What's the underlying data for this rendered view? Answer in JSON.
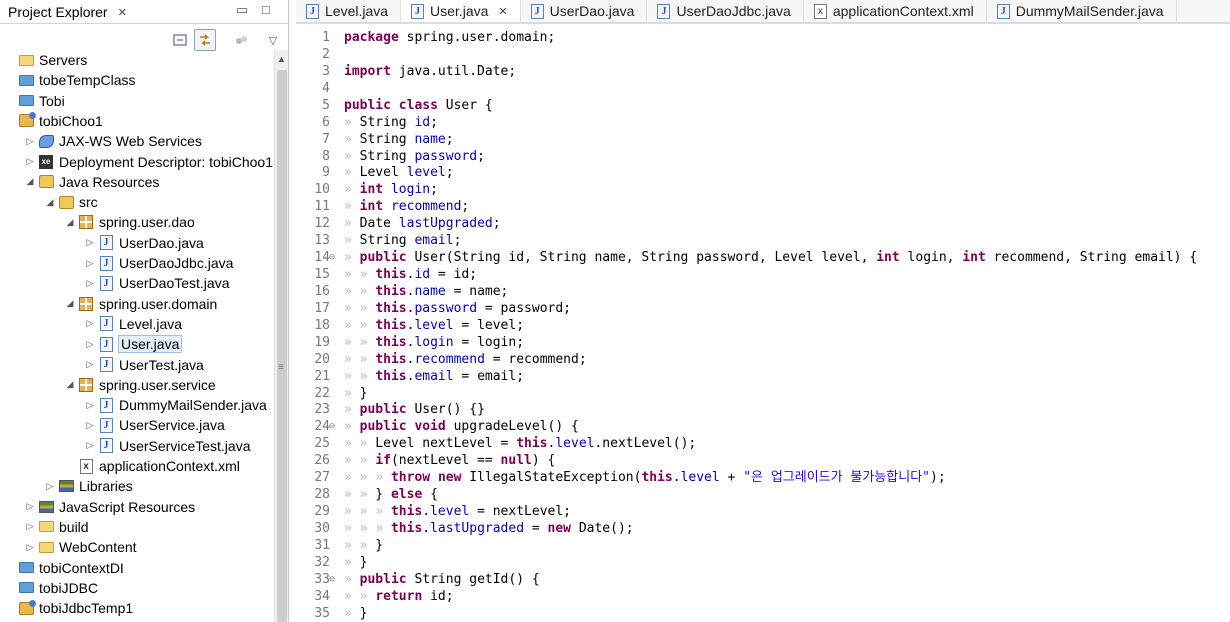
{
  "explorer": {
    "tab_label": "Project Explorer",
    "tab_close": "✕",
    "minimize": "▭",
    "maximize": "□",
    "view_menu": "▽",
    "tree": [
      {
        "label": "Servers",
        "icon": "folder-open-icon",
        "indent": 0,
        "twisty": ""
      },
      {
        "label": "tobeTempClass",
        "icon": "project-folder-icon",
        "indent": 0,
        "twisty": ""
      },
      {
        "label": "Tobi",
        "icon": "project-folder-icon",
        "indent": 0,
        "twisty": ""
      },
      {
        "label": "tobiChoo1",
        "icon": "web-project-icon",
        "indent": 0,
        "twisty": ""
      },
      {
        "label": "JAX-WS Web Services",
        "icon": "web-services-icon",
        "indent": 1,
        "twisty": "▷"
      },
      {
        "label": "Deployment Descriptor: tobiChoo1",
        "icon": "deployment-descriptor-icon",
        "indent": 1,
        "twisty": "▷"
      },
      {
        "label": "Java Resources",
        "icon": "java-resources-icon",
        "indent": 1,
        "twisty": "◢"
      },
      {
        "label": "src",
        "icon": "source-folder-icon",
        "indent": 2,
        "twisty": "◢"
      },
      {
        "label": "spring.user.dao",
        "icon": "package-icon",
        "indent": 3,
        "twisty": "◢"
      },
      {
        "label": "UserDao.java",
        "icon": "java-file-icon",
        "indent": 4,
        "twisty": "▷"
      },
      {
        "label": "UserDaoJdbc.java",
        "icon": "java-file-icon",
        "indent": 4,
        "twisty": "▷"
      },
      {
        "label": "UserDaoTest.java",
        "icon": "java-file-icon",
        "indent": 4,
        "twisty": "▷"
      },
      {
        "label": "spring.user.domain",
        "icon": "package-icon",
        "indent": 3,
        "twisty": "◢"
      },
      {
        "label": "Level.java",
        "icon": "java-file-icon",
        "indent": 4,
        "twisty": "▷"
      },
      {
        "label": "User.java",
        "icon": "java-file-icon",
        "indent": 4,
        "twisty": "▷",
        "selected": true
      },
      {
        "label": "UserTest.java",
        "icon": "java-file-icon",
        "indent": 4,
        "twisty": "▷"
      },
      {
        "label": "spring.user.service",
        "icon": "package-icon",
        "indent": 3,
        "twisty": "◢"
      },
      {
        "label": "DummyMailSender.java",
        "icon": "java-file-icon",
        "indent": 4,
        "twisty": "▷"
      },
      {
        "label": "UserService.java",
        "icon": "java-file-icon",
        "indent": 4,
        "twisty": "▷"
      },
      {
        "label": "UserServiceTest.java",
        "icon": "java-file-icon",
        "indent": 4,
        "twisty": "▷"
      },
      {
        "label": "applicationContext.xml",
        "icon": "xml-file-icon",
        "indent": 3,
        "twisty": ""
      },
      {
        "label": "Libraries",
        "icon": "libraries-icon",
        "indent": 2,
        "twisty": "▷"
      },
      {
        "label": "JavaScript Resources",
        "icon": "libraries-icon",
        "indent": 1,
        "twisty": "▷"
      },
      {
        "label": "build",
        "icon": "folder-open-icon",
        "indent": 1,
        "twisty": "▷"
      },
      {
        "label": "WebContent",
        "icon": "folder-open-icon",
        "indent": 1,
        "twisty": "▷"
      },
      {
        "label": "tobiContextDI",
        "icon": "project-folder-icon",
        "indent": 0,
        "twisty": ""
      },
      {
        "label": "tobiJDBC",
        "icon": "project-folder-icon",
        "indent": 0,
        "twisty": ""
      },
      {
        "label": "tobiJdbcTemp1",
        "icon": "web-project-icon",
        "indent": 0,
        "twisty": ""
      }
    ]
  },
  "editor": {
    "tabs": [
      {
        "label": "Level.java",
        "icon": "java-file-icon",
        "active": false
      },
      {
        "label": "User.java",
        "icon": "java-file-icon",
        "active": true
      },
      {
        "label": "UserDao.java",
        "icon": "java-file-icon",
        "active": false
      },
      {
        "label": "UserDaoJdbc.java",
        "icon": "java-file-icon",
        "active": false
      },
      {
        "label": "applicationContext.xml",
        "icon": "xml-file-icon",
        "active": false
      },
      {
        "label": "DummyMailSender.java",
        "icon": "java-file-icon",
        "active": false
      }
    ],
    "lines": [
      {
        "n": "1",
        "fold": "",
        "code": "package spring.user.domain;"
      },
      {
        "n": "2",
        "fold": "",
        "code": ""
      },
      {
        "n": "3",
        "fold": "",
        "code": "import java.util.Date;"
      },
      {
        "n": "4",
        "fold": "",
        "code": ""
      },
      {
        "n": "5",
        "fold": "",
        "code": "public class User {"
      },
      {
        "n": "6",
        "fold": "",
        "code": "» String id;"
      },
      {
        "n": "7",
        "fold": "",
        "code": "» String name;"
      },
      {
        "n": "8",
        "fold": "",
        "code": "» String password;"
      },
      {
        "n": "9",
        "fold": "",
        "code": "» Level level;"
      },
      {
        "n": "10",
        "fold": "",
        "code": "» int login;"
      },
      {
        "n": "11",
        "fold": "",
        "code": "» int recommend;"
      },
      {
        "n": "12",
        "fold": "",
        "code": "» Date lastUpgraded;"
      },
      {
        "n": "13",
        "fold": "",
        "code": "» String email;"
      },
      {
        "n": "14",
        "fold": "⊖",
        "code": "» public User(String id, String name, String password, Level level, int login, int recommend, String email) {"
      },
      {
        "n": "15",
        "fold": "",
        "code": "» » this.id = id;"
      },
      {
        "n": "16",
        "fold": "",
        "code": "» » this.name = name;"
      },
      {
        "n": "17",
        "fold": "",
        "code": "» » this.password = password;"
      },
      {
        "n": "18",
        "fold": "",
        "code": "» » this.level = level;"
      },
      {
        "n": "19",
        "fold": "",
        "code": "» » this.login = login;"
      },
      {
        "n": "20",
        "fold": "",
        "code": "» » this.recommend = recommend;"
      },
      {
        "n": "21",
        "fold": "",
        "code": "» » this.email = email;"
      },
      {
        "n": "22",
        "fold": "",
        "code": "» }"
      },
      {
        "n": "23",
        "fold": "",
        "code": "» public User() {}"
      },
      {
        "n": "24",
        "fold": "⊖",
        "code": "» public void upgradeLevel() {"
      },
      {
        "n": "25",
        "fold": "",
        "code": "» » Level nextLevel = this.level.nextLevel();"
      },
      {
        "n": "26",
        "fold": "",
        "code": "» » if(nextLevel == null) {"
      },
      {
        "n": "27",
        "fold": "",
        "code": "» » » throw new IllegalStateException(this.level + \"은 업그레이드가 불가능합니다\");"
      },
      {
        "n": "28",
        "fold": "",
        "code": "» » } else {"
      },
      {
        "n": "29",
        "fold": "",
        "code": "» » » this.level = nextLevel;"
      },
      {
        "n": "30",
        "fold": "",
        "code": "» » » this.lastUpgraded = new Date();"
      },
      {
        "n": "31",
        "fold": "",
        "code": "» » }"
      },
      {
        "n": "32",
        "fold": "",
        "code": "» }"
      },
      {
        "n": "33",
        "fold": "⊖",
        "code": "» public String getId() {"
      },
      {
        "n": "34",
        "fold": "",
        "code": "» » return id;"
      },
      {
        "n": "35",
        "fold": "",
        "code": "» }"
      }
    ]
  },
  "colors": {
    "keyword": "#7f0055",
    "field": "#0000c0",
    "string": "#2a00ff",
    "line_number": "#787878",
    "selection": "#e6f0fa"
  }
}
